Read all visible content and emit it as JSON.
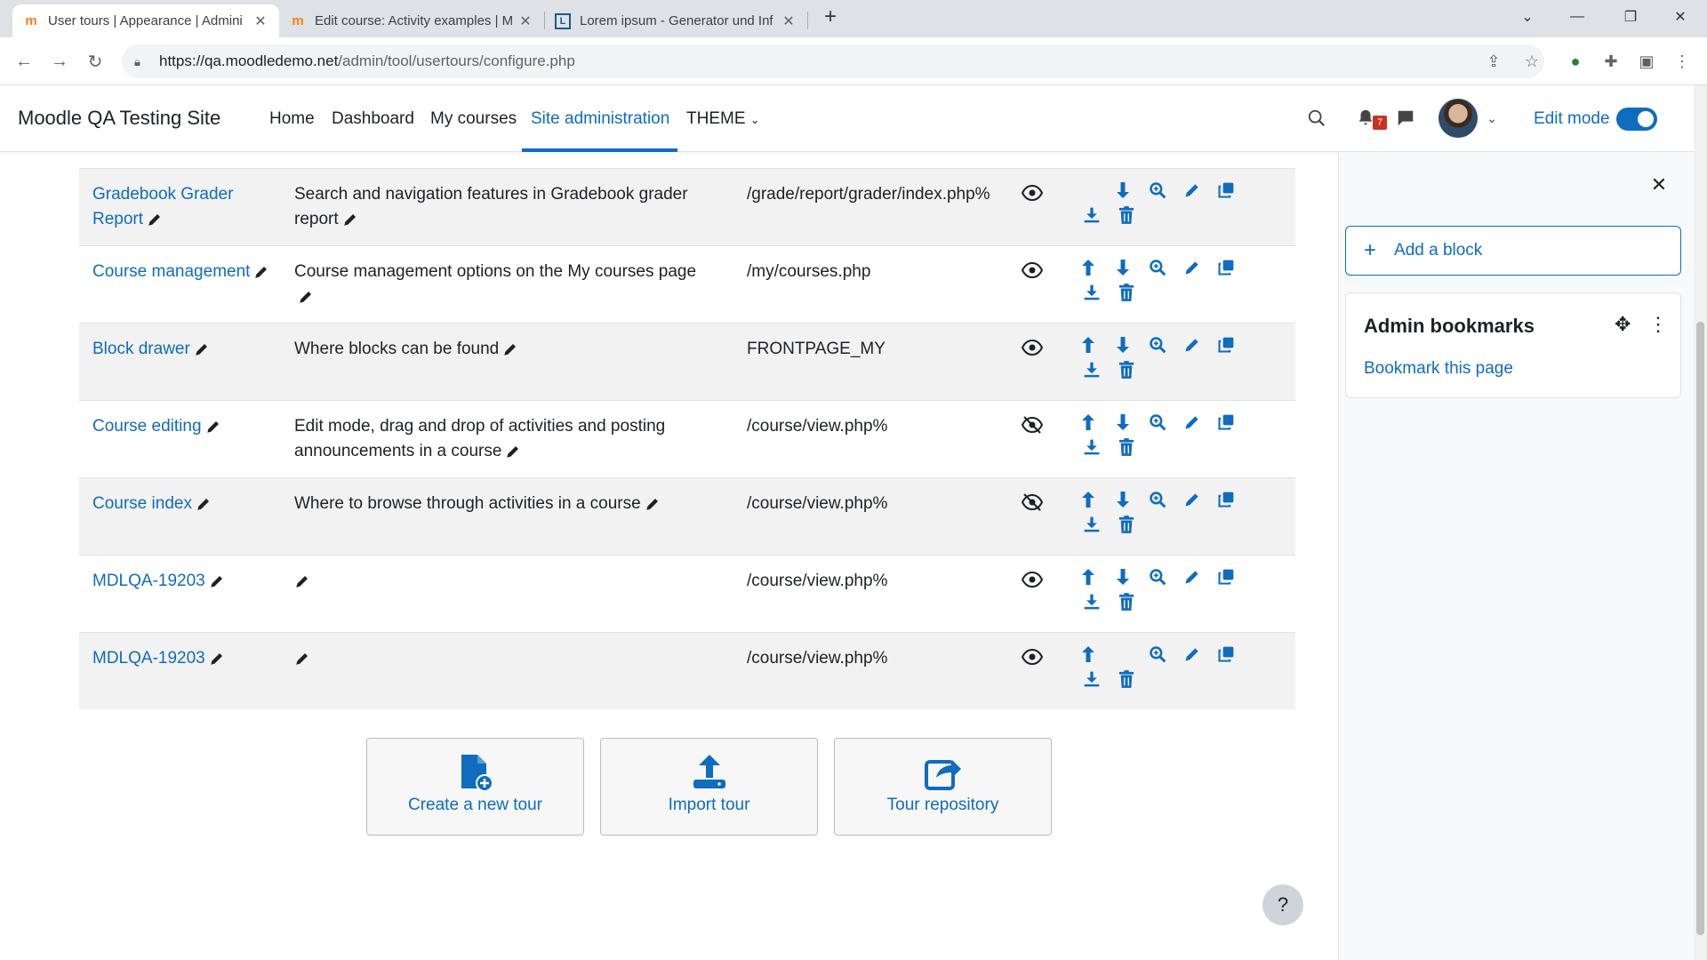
{
  "browser": {
    "tabs": [
      {
        "title": "User tours | Appearance | Admini",
        "active": true,
        "icon": "moodle-icon"
      },
      {
        "title": "Edit course: Activity examples | M",
        "active": false,
        "icon": "moodle-icon"
      },
      {
        "title": "Lorem ipsum - Generator und Inf",
        "active": false,
        "icon": "lorem-icon"
      }
    ],
    "url_host": "https://qa.moodledemo.net",
    "url_path": "/admin/tool/usertours/configure.php"
  },
  "navbar": {
    "brand": "Moodle QA Testing Site",
    "links": [
      {
        "label": "Home",
        "active": false
      },
      {
        "label": "Dashboard",
        "active": false
      },
      {
        "label": "My courses",
        "active": false
      },
      {
        "label": "Site administration",
        "active": true
      },
      {
        "label": "THEME",
        "active": false
      }
    ],
    "notification_count": "7",
    "edit_mode_label": "Edit mode",
    "edit_mode_on": true
  },
  "tours": [
    {
      "name": "Gradebook Grader Report",
      "description": "Search and navigation features in Gradebook grader report",
      "path": "/grade/report/grader/index.php%",
      "visible": true,
      "can_move_up": false,
      "can_move_down": true
    },
    {
      "name": "Course management",
      "description": "Course management options on the My courses page",
      "path": "/my/courses.php",
      "visible": true,
      "can_move_up": true,
      "can_move_down": true
    },
    {
      "name": "Block drawer",
      "description": "Where blocks can be found",
      "path": "FRONTPAGE_MY",
      "visible": true,
      "can_move_up": true,
      "can_move_down": true
    },
    {
      "name": "Course editing",
      "description": "Edit mode, drag and drop of activities and posting announcements in a course",
      "path": "/course/view.php%",
      "visible": false,
      "can_move_up": true,
      "can_move_down": true
    },
    {
      "name": "Course index",
      "description": "Where to browse through activities in a course",
      "path": "/course/view.php%",
      "visible": false,
      "can_move_up": true,
      "can_move_down": true
    },
    {
      "name": "MDLQA-19203",
      "description": "",
      "path": "/course/view.php%",
      "visible": true,
      "can_move_up": true,
      "can_move_down": true
    },
    {
      "name": "MDLQA-19203",
      "description": "",
      "path": "/course/view.php%",
      "visible": true,
      "can_move_up": true,
      "can_move_down": false
    }
  ],
  "actions": {
    "create": "Create a new tour",
    "import": "Import tour",
    "repository": "Tour repository"
  },
  "drawer": {
    "add_block": "Add a block",
    "bookmarks_title": "Admin bookmarks",
    "bookmark_link": "Bookmark this page"
  },
  "help_label": "?",
  "colors": {
    "accent": "#0f6cbf",
    "badge": "#ca3120"
  }
}
